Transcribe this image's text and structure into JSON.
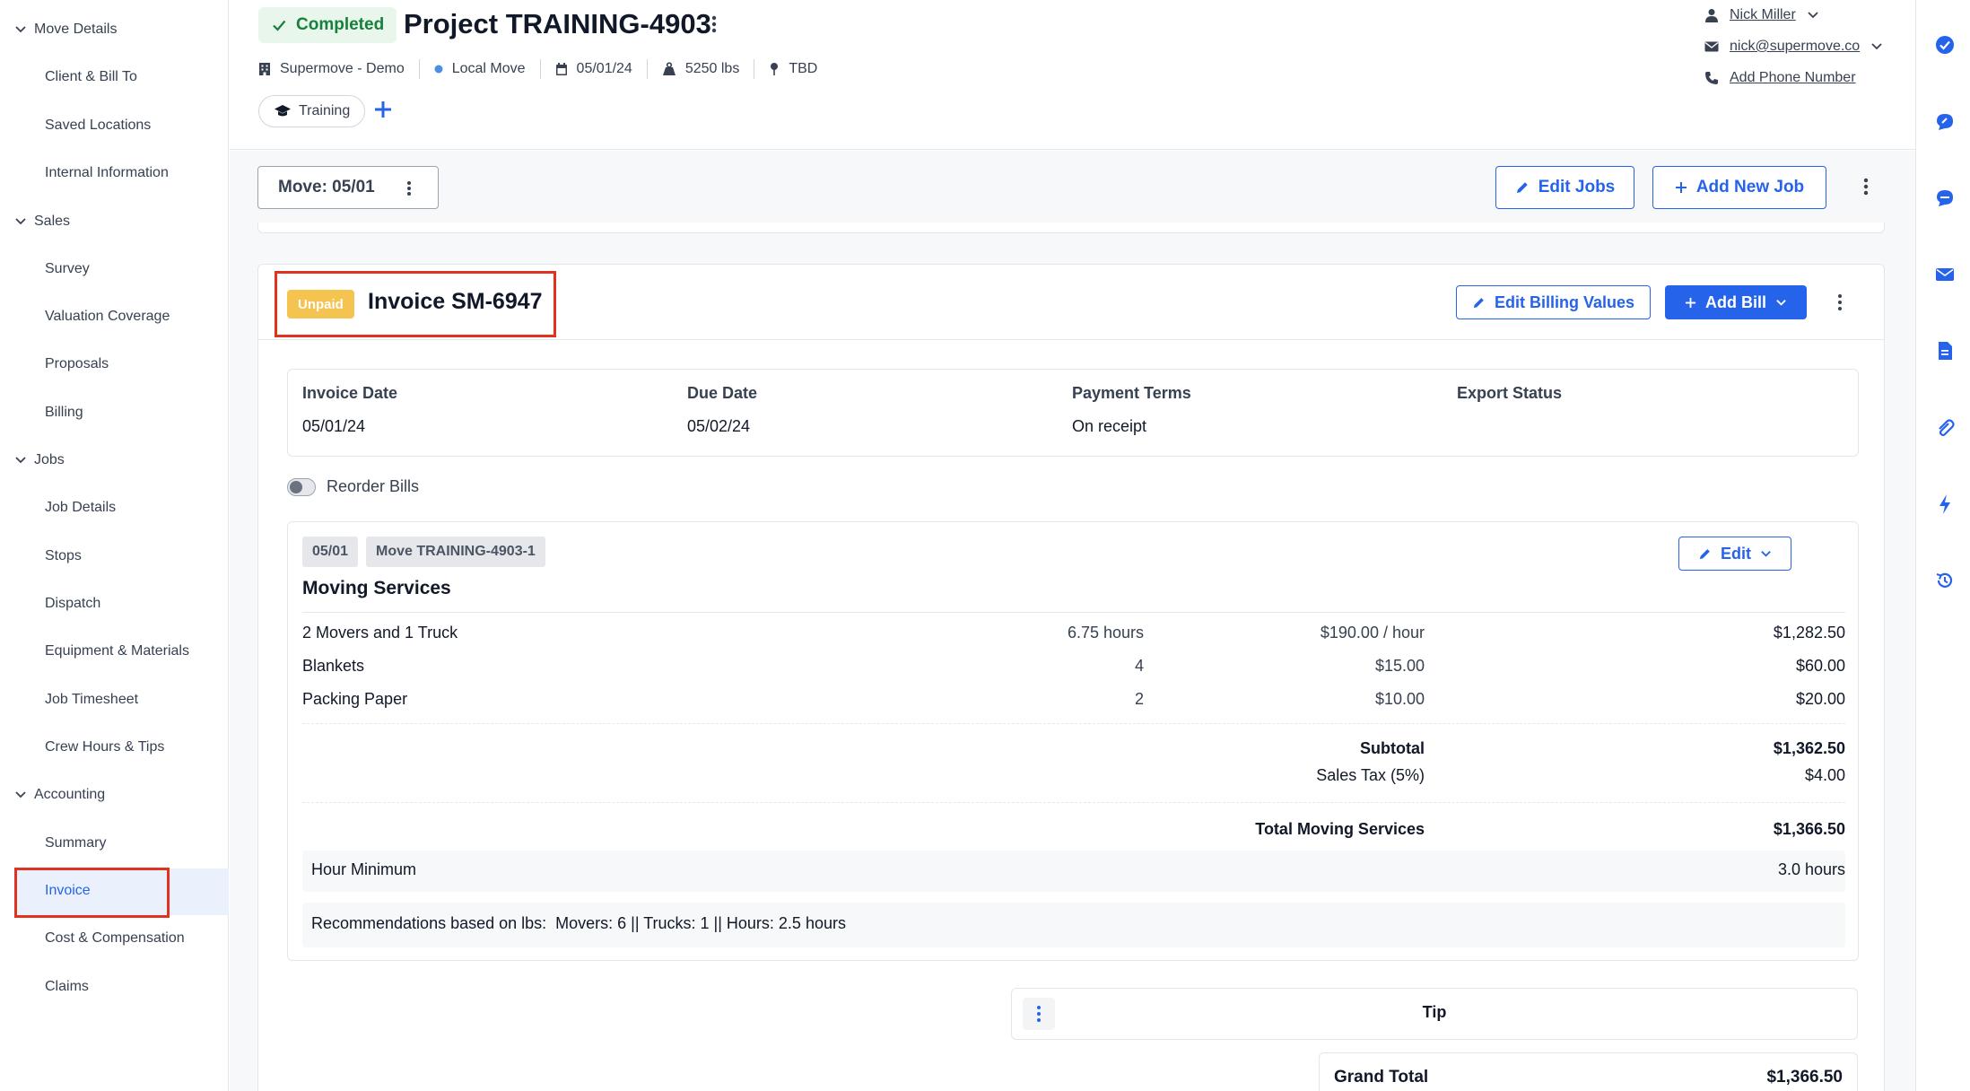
{
  "sidebar": {
    "sections": [
      {
        "label": "Move Details",
        "items": [
          "Client & Bill To",
          "Saved Locations",
          "Internal Information"
        ]
      },
      {
        "label": "Sales",
        "items": [
          "Survey",
          "Valuation Coverage",
          "Proposals",
          "Billing"
        ]
      },
      {
        "label": "Jobs",
        "items": [
          "Job Details",
          "Stops",
          "Dispatch",
          "Equipment & Materials",
          "Job Timesheet",
          "Crew Hours & Tips"
        ]
      },
      {
        "label": "Accounting",
        "items": [
          "Summary",
          "Invoice",
          "Cost & Compensation",
          "Claims"
        ]
      }
    ],
    "active_item": "Invoice"
  },
  "header": {
    "status": "Completed",
    "project_title": "Project TRAINING-4903",
    "meta": {
      "company": "Supermove - Demo",
      "move_type": "Local Move",
      "date": "05/01/24",
      "weight": "5250 lbs",
      "location": "TBD"
    },
    "tag": "Training",
    "contact": {
      "name": "Nick Miller",
      "email": "nick@supermove.co",
      "phone_placeholder": "Add Phone Number"
    }
  },
  "toolbar": {
    "move_selector": "Move: 05/01",
    "edit_jobs": "Edit Jobs",
    "add_new_job": "Add New Job"
  },
  "invoice": {
    "status_badge": "Unpaid",
    "title": "Invoice SM-6947",
    "edit_billing_values": "Edit Billing Values",
    "add_bill": "Add Bill",
    "details": [
      {
        "label": "Invoice Date",
        "value": "05/01/24"
      },
      {
        "label": "Due Date",
        "value": "05/02/24"
      },
      {
        "label": "Payment Terms",
        "value": "On receipt"
      },
      {
        "label": "Export Status",
        "value": ""
      }
    ],
    "reorder_bills_label": "Reorder Bills",
    "bill": {
      "date_chip": "05/01",
      "job_chip": "Move TRAINING-4903-1",
      "edit_label": "Edit",
      "title": "Moving Services",
      "line_items": [
        {
          "name": "2 Movers and 1 Truck",
          "qty": "6.75 hours",
          "rate": "$190.00 / hour",
          "total": "$1,282.50"
        },
        {
          "name": "Blankets",
          "qty": "4",
          "rate": "$15.00",
          "total": "$60.00"
        },
        {
          "name": "Packing Paper",
          "qty": "2",
          "rate": "$10.00",
          "total": "$20.00"
        }
      ],
      "subtotal_label": "Subtotal",
      "subtotal_value": "$1,362.50",
      "tax_label": "Sales Tax (5%)",
      "tax_value": "$4.00",
      "total_label": "Total Moving Services",
      "total_value": "$1,366.50",
      "hour_minimum_label": "Hour Minimum",
      "hour_minimum_value": "3.0 hours",
      "recommendations": "Recommendations based on lbs:  Movers: 6 || Trucks: 1 || Hours: 2.5 hours"
    },
    "tip_label": "Tip",
    "grand_total_label": "Grand Total",
    "grand_total_value": "$1,366.50"
  },
  "colors": {
    "accent": "#2563eb",
    "completed_bg": "#e8f6ec",
    "completed_text": "#16803c",
    "unpaid": "#f5c350",
    "highlight_box": "#e0321e"
  }
}
